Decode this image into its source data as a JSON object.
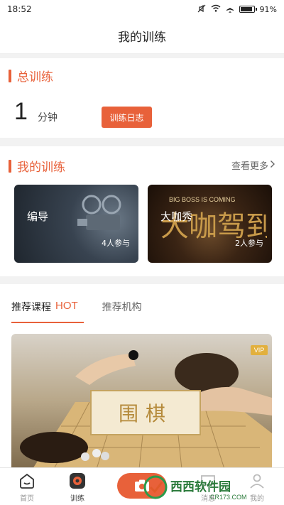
{
  "status_bar": {
    "time": "18:52",
    "battery": "91%"
  },
  "nav": {
    "title": "我的训练"
  },
  "total_training": {
    "title": "总训练",
    "value": "1",
    "unit": "分钟",
    "log_button": "训练日志"
  },
  "my_training": {
    "title": "我的训练",
    "more_label": "查看更多",
    "courses": [
      {
        "title": "编导",
        "count": "4人参与"
      },
      {
        "title": "大咖秀",
        "count": "2人参与",
        "art_text": "BIG BOSS IS COMING",
        "art_title": "大咖驾到"
      }
    ]
  },
  "recommend": {
    "tabs": [
      {
        "label": "推荐课程",
        "badge": "HOT"
      },
      {
        "label": "推荐机构"
      }
    ],
    "banner": {
      "vip": "VIP",
      "title": "围棋"
    }
  },
  "tab_bar": {
    "items": [
      {
        "label": "首页"
      },
      {
        "label": "训练"
      },
      {
        "label": "消息"
      },
      {
        "label": "我的"
      }
    ]
  },
  "watermark": {
    "text": "西西软件园",
    "url": "CR173.COM"
  },
  "colors": {
    "accent": "#e8613a",
    "text": "#333333",
    "vip": "#e2b03e"
  }
}
